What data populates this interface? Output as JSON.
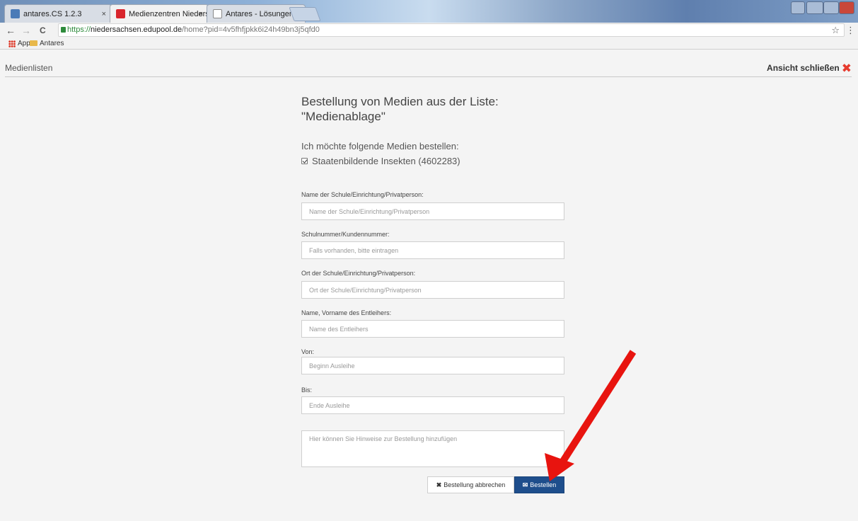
{
  "browser": {
    "tabs": [
      {
        "title": "antares.CS 1.2.3"
      },
      {
        "title": "Medienzentren Niedersa"
      },
      {
        "title": "Antares - Lösungen für d"
      }
    ],
    "tab_close": "×",
    "url": {
      "scheme": "https://",
      "domain": "niedersachsen.edupool.de",
      "path": "/home?pid=4v5fhfjpkk6i24h49bn3j5qfd0"
    },
    "bookmarks": [
      {
        "label": "Apps"
      },
      {
        "label": "Antares"
      }
    ],
    "nav": {
      "back": "←",
      "forward": "→",
      "reload": "C",
      "star": "☆",
      "menu": "⋮"
    }
  },
  "page": {
    "title": "Medienlisten",
    "close_view_label": "Ansicht schließen",
    "close_icon": "✖"
  },
  "form": {
    "heading_line1": "Bestellung von Medien aus der Liste:",
    "heading_line2": "\"Medienablage\"",
    "intro": "Ich möchte folgende Medien bestellen:",
    "item": {
      "label": "Staatenbildende Insekten (4602283)",
      "checked": true
    },
    "fields": [
      {
        "label": "Name der Schule/Einrichtung/Privatperson:",
        "placeholder": "Name der Schule/Einrichtung/Privatperson",
        "value": ""
      },
      {
        "label": "Schulnummer/Kundennummer:",
        "placeholder": "Falls vorhanden, bitte eintragen",
        "value": ""
      },
      {
        "label": "Ort der Schule/Einrichtung/Privatperson:",
        "placeholder": "Ort der Schule/Einrichtung/Privatperson",
        "value": ""
      },
      {
        "label": "Name, Vorname des Entleihers:",
        "placeholder": "Name des Entleihers",
        "value": ""
      },
      {
        "label": "Von:",
        "placeholder": "Beginn Ausleihe",
        "value": ""
      },
      {
        "label": "Bis:",
        "placeholder": "Ende Ausleihe",
        "value": ""
      }
    ],
    "notes_placeholder": "Hier können Sie Hinweise zur Bestellung hinzufügen",
    "cancel": {
      "icon": "✖",
      "label": "Bestellung abbrechen"
    },
    "submit": {
      "icon": "✉",
      "label": "Bestellen"
    }
  },
  "colors": {
    "primary_button": "#1e4e8c",
    "close_icon": "#e63b2e",
    "annotation_arrow": "#e8140f"
  }
}
